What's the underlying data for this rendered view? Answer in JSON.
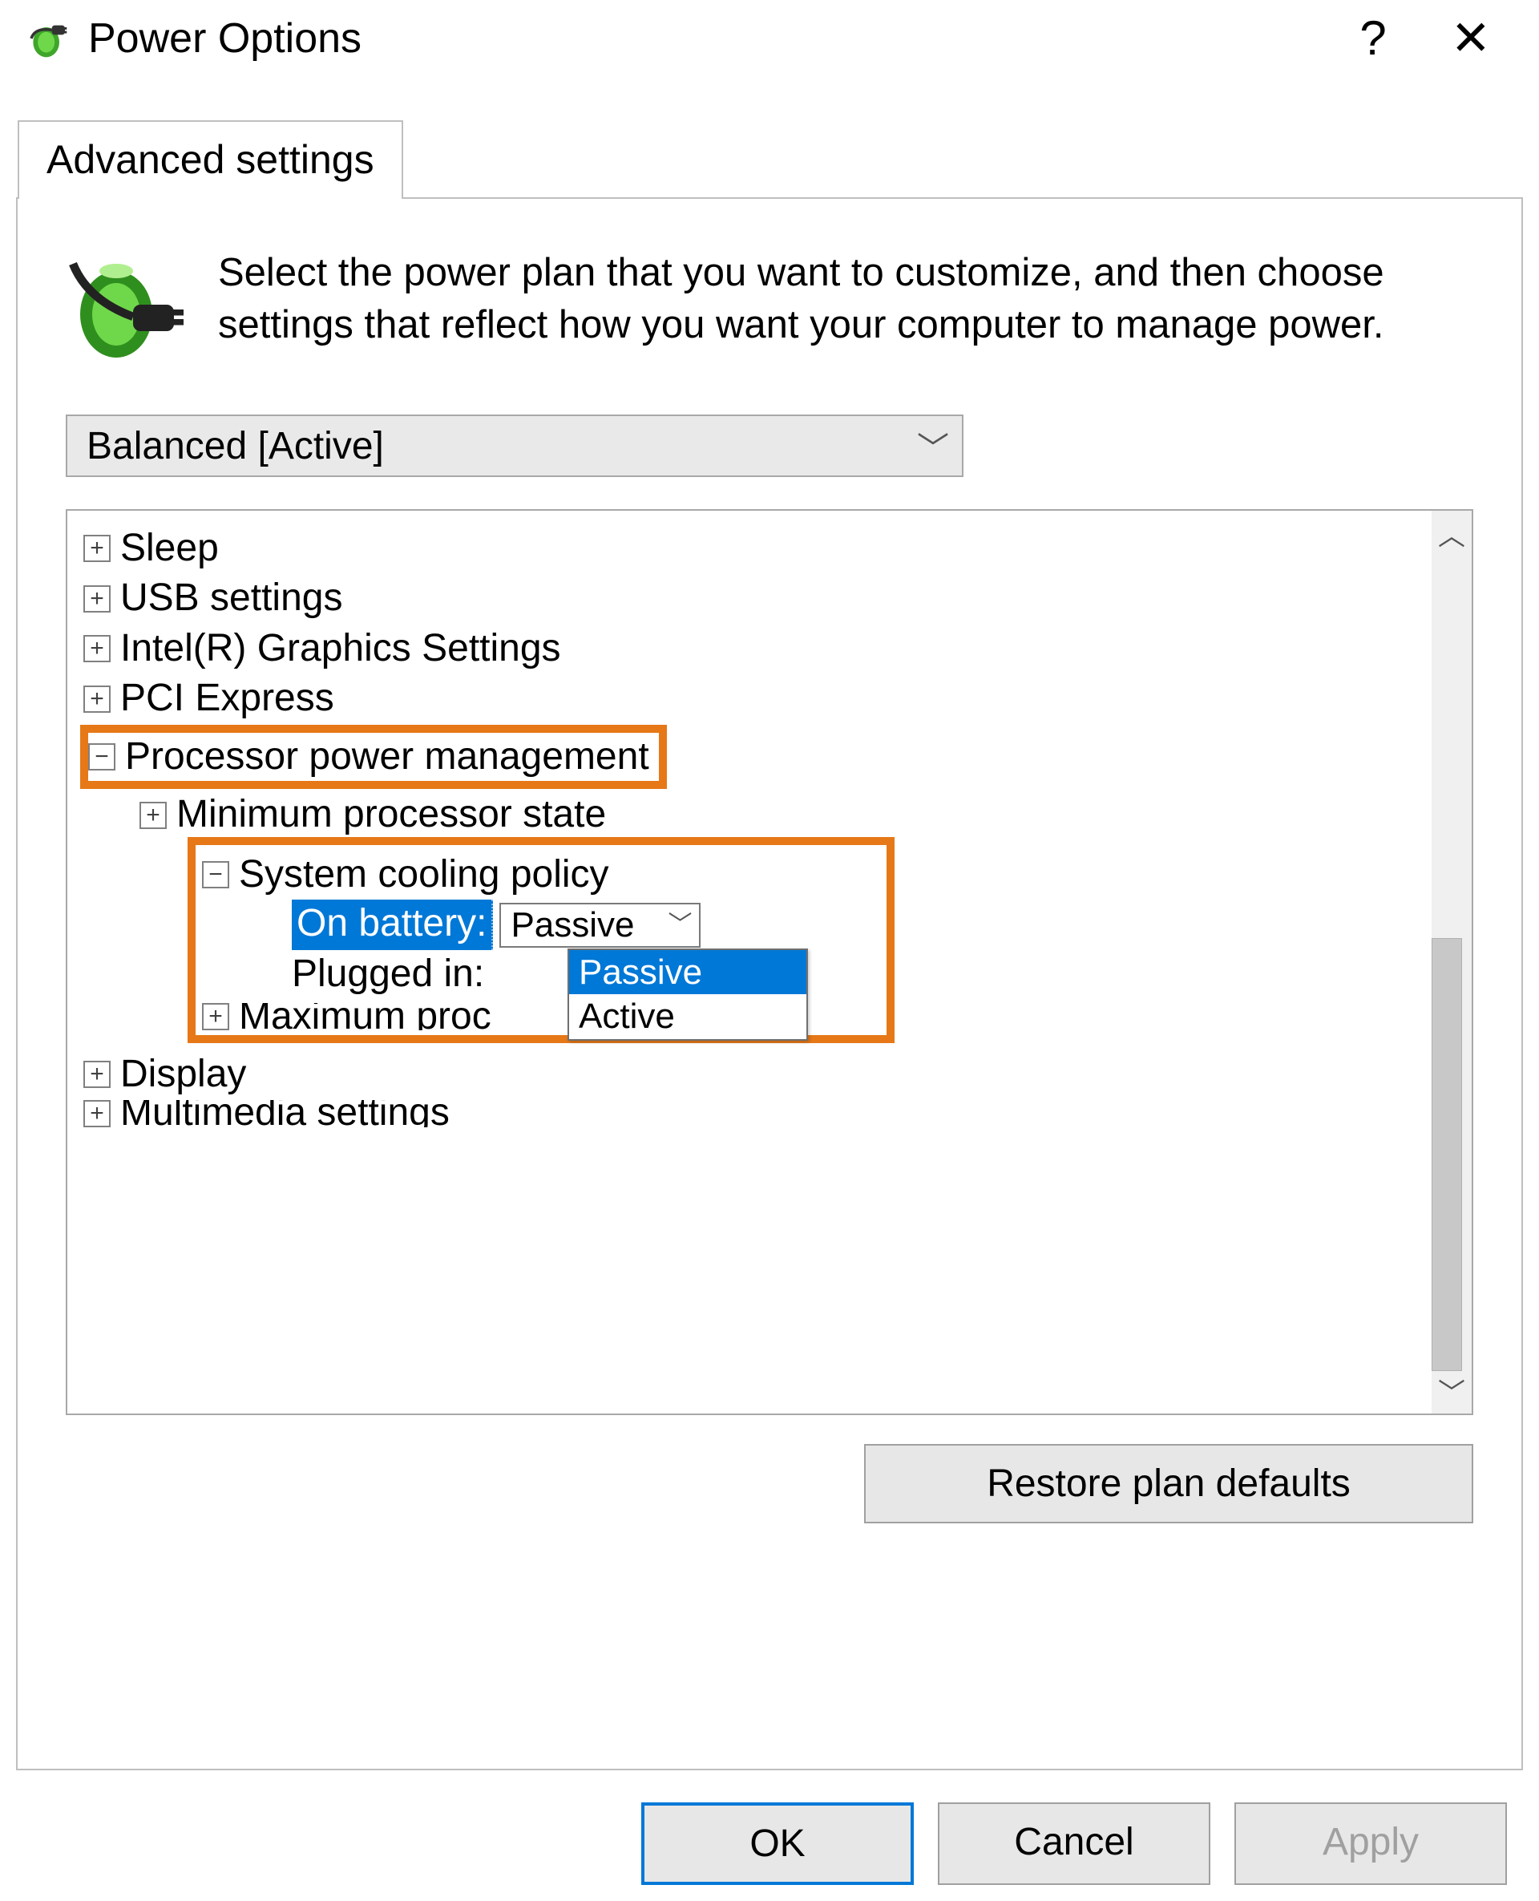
{
  "window": {
    "title": "Power Options",
    "help_glyph": "?",
    "close_glyph": "✕"
  },
  "tab": {
    "label": "Advanced settings"
  },
  "intro": {
    "text": "Select the power plan that you want to customize, and then choose settings that reflect how you want your computer to manage power."
  },
  "plan_select": {
    "value": "Balanced [Active]"
  },
  "tree": {
    "items": [
      {
        "label": "Sleep",
        "expanded": false
      },
      {
        "label": "USB settings",
        "expanded": false
      },
      {
        "label": "Intel(R) Graphics Settings",
        "expanded": false
      },
      {
        "label": "PCI Express",
        "expanded": false
      },
      {
        "label": "Processor power management",
        "expanded": true,
        "highlighted": true
      },
      {
        "label": "Display",
        "expanded": false
      },
      {
        "label": "Multimedia settings",
        "expanded": false
      }
    ],
    "ppm_children": [
      {
        "label": "Minimum processor state",
        "expanded": false
      },
      {
        "label": "System cooling policy",
        "expanded": true
      },
      {
        "label": "Maximum processor state",
        "expanded": false,
        "truncated": true,
        "visible_text": "Maximum processor state"
      }
    ],
    "cooling": {
      "on_battery_label": "On battery:",
      "on_battery_value": "Passive",
      "plugged_in_label": "Plugged in:",
      "plugged_in_value": "Passive",
      "dropdown_options": [
        "Passive",
        "Active"
      ],
      "dropdown_selected": "Passive"
    },
    "truncated_max_label": "Maximum proc"
  },
  "buttons": {
    "restore": "Restore plan defaults",
    "ok": "OK",
    "cancel": "Cancel",
    "apply": "Apply"
  },
  "highlight_color": "#e67817",
  "selection_color": "#0078d7"
}
